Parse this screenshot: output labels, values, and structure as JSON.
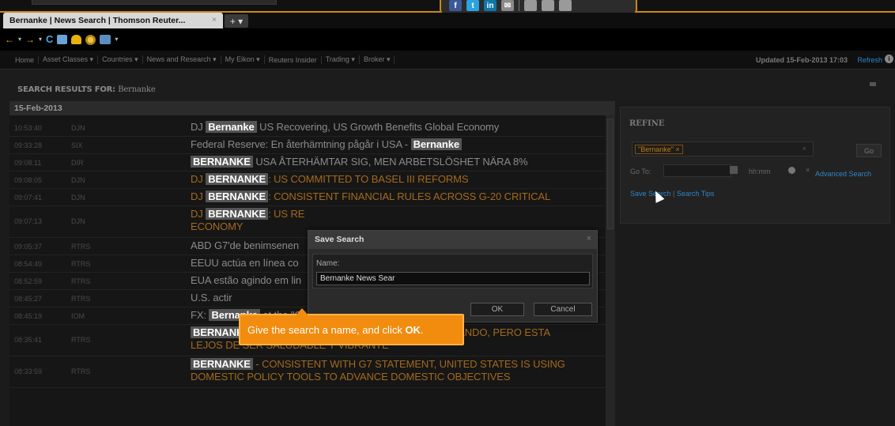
{
  "browser": {
    "tab_title": "Bernanke | News Search | Thomson Reuter...",
    "tab_close": "×",
    "new_tab": "+ ▾",
    "social": [
      "f",
      "t",
      "in",
      "✉",
      "",
      "",
      ""
    ]
  },
  "nav": {
    "items": [
      "Home",
      "Asset Classes ▾",
      "Countries ▾",
      "News and Research ▾",
      "My Eikon ▾",
      "Reuters Insider",
      "Trading ▾",
      "Broker ▾"
    ],
    "updated": "Updated 15-Feb-2013 17:03",
    "refresh": "Refresh",
    "info": "i"
  },
  "search": {
    "label_prefix": "SEARCH RESULTS FOR:",
    "query": "Bernanke",
    "date": "15-Feb-2013"
  },
  "results": [
    {
      "time": "10:53:40",
      "source": "DJN",
      "pre": "DJ ",
      "hl": "Bernanke",
      "post": " US Recovering, US Growth Benefits Global Economy",
      "color": "gray"
    },
    {
      "time": "09:33:28",
      "source": "SIX",
      "pre": "Federal Reserve: En återhämtning pågår i USA - ",
      "hl": "Bernanke",
      "post": "",
      "color": "gray"
    },
    {
      "time": "09:08:11",
      "source": "DIR",
      "pre": "",
      "hl": "BERNANKE",
      "post": " USA ÅTERHÄMTAR SIG, MEN ARBETSLÖSHET NÄRA 8%",
      "color": "gray"
    },
    {
      "time": "09:08:05",
      "source": "DJN",
      "pre": "DJ ",
      "hl": "BERNANKE",
      "post": ": US COMMITTED TO BASEL III REFORMS",
      "color": "orange"
    },
    {
      "time": "09:07:41",
      "source": "DJN",
      "pre": "DJ ",
      "hl": "BERNANKE",
      "post": ": CONSISTENT FINANCIAL RULES ACROSS G-20 CRITICAL",
      "color": "orange"
    },
    {
      "time": "09:07:13",
      "source": "DJN",
      "pre": "DJ ",
      "hl": "BERNANKE",
      "post": ": US RE",
      "post2": "ECONOMY",
      "color": "orange"
    },
    {
      "time": "09:05:37",
      "source": "RTRS",
      "pre": "ABD G7'de benimsenen",
      "hl": "",
      "post": "",
      "color": "gray"
    },
    {
      "time": "08:54:49",
      "source": "RTRS",
      "pre": "EEUU actúa en línea co",
      "hl": "",
      "post": "",
      "color": "gray"
    },
    {
      "time": "08:52:59",
      "source": "RTRS",
      "pre": "EUA estão agindo em lin",
      "hl": "",
      "post": "",
      "color": "gray"
    },
    {
      "time": "08:45:27",
      "source": "RTRS",
      "pre": "U.S. actir",
      "hl": "",
      "post": "",
      "color": "gray"
    },
    {
      "time": "08:45:19",
      "source": "IOM",
      "pre": "FX: ",
      "hl": "Bernanke",
      "post": " at the \"G\" Meeting - See, I Was Right",
      "color": "gray"
    },
    {
      "time": "08:35:41",
      "source": "RTRS",
      "pre": "",
      "hl": "BERNANKE",
      "post": ": ECONOMIA DE EEUU SE ESTA RECUPERANDO, PERO ESTA",
      "post2": "LEJOS DE SER SALUDABLE Y VIBRANTE",
      "color": "orange"
    },
    {
      "time": "08:33:59",
      "source": "RTRS",
      "pre": "",
      "hl": "BERNANKE",
      "post": " - CONSISTENT WITH G7 STATEMENT, UNITED STATES IS USING",
      "post2": "DOMESTIC POLICY TOOLS TO ADVANCE DOMESTIC OBJECTIVES",
      "color": "orange"
    }
  ],
  "refine": {
    "title": "REFINE",
    "tag": "\"Bernanke\" ×",
    "tag_clear": "×",
    "go": "Go",
    "goto_label": "Go To:",
    "hhmm": "hh:mm",
    "time_clear": "×",
    "advanced": "Advanced Search",
    "save_search": "Save Search",
    "separator": "|",
    "search_tips": "Search Tips"
  },
  "dialog": {
    "title": "Save Search",
    "close": "×",
    "name_label": "Name:",
    "name_value": "Bernanke News Sear",
    "ok": "OK",
    "cancel": "Cancel"
  },
  "tooltip": {
    "text_pre": "Give the search a name, and click ",
    "text_bold": "OK",
    "text_post": "."
  },
  "colors": {
    "accent_orange": "#f28c0f",
    "headline_orange": "#a36a1c",
    "link_blue": "#2d86c8"
  }
}
